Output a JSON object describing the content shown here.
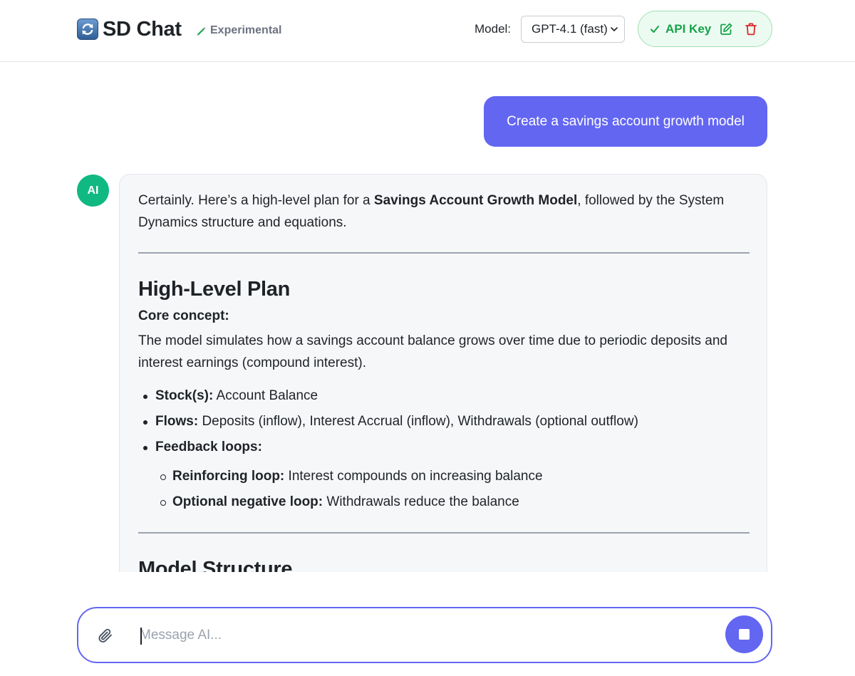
{
  "header": {
    "app_title": "SD Chat",
    "badge": "Experimental",
    "model_label": "Model:",
    "model_selected": "GPT-4.1 (fast)",
    "api_key_label": "API Key"
  },
  "colors": {
    "accent": "#6366f1",
    "ai_avatar": "#10b981",
    "api_green": "#16a34a",
    "delete_red": "#dc2626"
  },
  "chat": {
    "user_message": "Create a savings account growth model",
    "ai_avatar_label": "AI",
    "ai_message": {
      "intro_before": "Certainly. Here’s a high-level plan for a ",
      "intro_bold": "Savings Account Growth Model",
      "intro_after": ", followed by the System Dynamics structure and equations.",
      "section1_title": "High-Level Plan",
      "core_label": "Core concept:",
      "core_text": "The model simulates how a savings account balance grows over time due to periodic deposits and interest earnings (compound interest).",
      "bullets": [
        {
          "label": "Stock(s):",
          "text": " Account Balance"
        },
        {
          "label": "Flows:",
          "text": " Deposits (inflow), Interest Accrual (inflow), Withdrawals (optional outflow)"
        },
        {
          "label": "Feedback loops:",
          "text": ""
        }
      ],
      "sub_bullets": [
        {
          "label": "Reinforcing loop:",
          "text": " Interest compounds on increasing balance"
        },
        {
          "label": "Optional negative loop:",
          "text": " Withdrawals reduce the balance"
        }
      ],
      "section2_title": "Model Structure"
    }
  },
  "composer": {
    "placeholder": "Message AI..."
  },
  "icons": {
    "logo": "refresh-logo-icon",
    "experimental": "pencil-icon",
    "select": "chevron-down-icon",
    "api_status": "check-icon",
    "api_edit": "edit-icon",
    "api_delete": "trash-icon",
    "attach": "paperclip-icon",
    "stop": "stop-icon"
  }
}
